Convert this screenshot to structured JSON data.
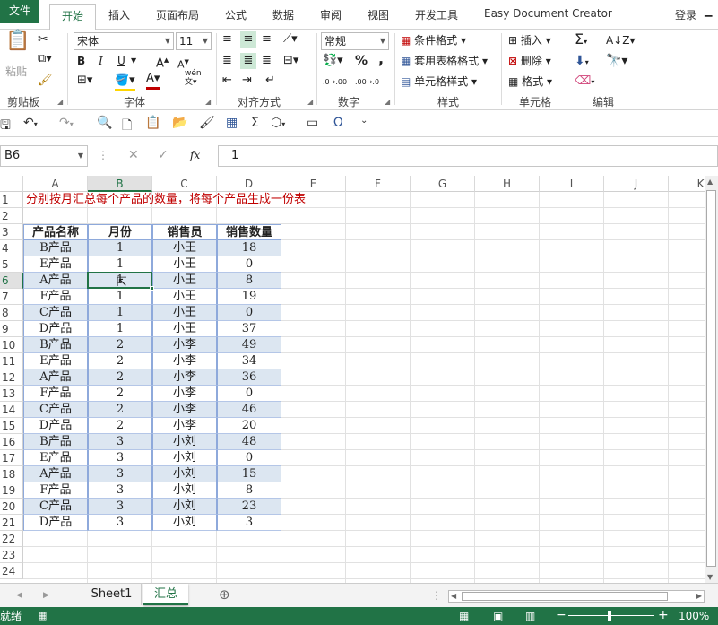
{
  "tabs": [
    "文件",
    "开始",
    "插入",
    "页面布局",
    "公式",
    "数据",
    "审阅",
    "视图",
    "开发工具",
    "Easy Document Creator"
  ],
  "login": "登录",
  "ribbon": {
    "paste": "粘贴",
    "font_name": "宋体",
    "font_size": "11",
    "wen": "wén",
    "number_format": "常规",
    "percent": "%",
    "comma": ",",
    "dec_inc": ".0→.00",
    "dec_dec": ".00→.0",
    "cond_format": "条件格式",
    "table_format": "套用表格格式",
    "cell_style": "单元格样式",
    "insert": "插入",
    "delete": "删除",
    "format": "格式",
    "groups": {
      "clipboard": "剪贴板",
      "font": "字体",
      "alignment": "对齐方式",
      "number": "数字",
      "styles": "样式",
      "cells": "单元格",
      "editing": "编辑"
    }
  },
  "formula_bar": {
    "name_box": "B6",
    "value": "1"
  },
  "grid": {
    "columns": [
      "A",
      "B",
      "C",
      "D",
      "E",
      "F",
      "G",
      "H",
      "I",
      "J",
      "K"
    ],
    "rows": [
      "1",
      "2",
      "3",
      "4",
      "5",
      "6",
      "7",
      "8",
      "9",
      "10",
      "11",
      "12",
      "13",
      "14",
      "15",
      "16",
      "17",
      "18",
      "19",
      "20",
      "21",
      "22",
      "23",
      "24"
    ],
    "title": "分别按月汇总每个产品的数量，将每个产品生成一份表",
    "headers": [
      "产品名称",
      "月份",
      "销售员",
      "销售数量"
    ],
    "data": [
      [
        "B产品",
        "1",
        "小王",
        "18"
      ],
      [
        "E产品",
        "1",
        "小王",
        "0"
      ],
      [
        "A产品",
        "1",
        "小王",
        "8"
      ],
      [
        "F产品",
        "1",
        "小王",
        "19"
      ],
      [
        "C产品",
        "1",
        "小王",
        "0"
      ],
      [
        "D产品",
        "1",
        "小王",
        "37"
      ],
      [
        "B产品",
        "2",
        "小李",
        "49"
      ],
      [
        "E产品",
        "2",
        "小李",
        "34"
      ],
      [
        "A产品",
        "2",
        "小李",
        "36"
      ],
      [
        "F产品",
        "2",
        "小李",
        "0"
      ],
      [
        "C产品",
        "2",
        "小李",
        "46"
      ],
      [
        "D产品",
        "2",
        "小李",
        "20"
      ],
      [
        "B产品",
        "3",
        "小刘",
        "48"
      ],
      [
        "E产品",
        "3",
        "小刘",
        "0"
      ],
      [
        "A产品",
        "3",
        "小刘",
        "15"
      ],
      [
        "F产品",
        "3",
        "小刘",
        "8"
      ],
      [
        "C产品",
        "3",
        "小刘",
        "23"
      ],
      [
        "D产品",
        "3",
        "小刘",
        "3"
      ]
    ]
  },
  "sheets": [
    "Sheet1",
    "汇总"
  ],
  "status": {
    "ready": "就绪",
    "zoom": "100%"
  },
  "colors": {
    "accent": "#217346",
    "band": "#dce6f1",
    "title_red": "#c00000"
  }
}
